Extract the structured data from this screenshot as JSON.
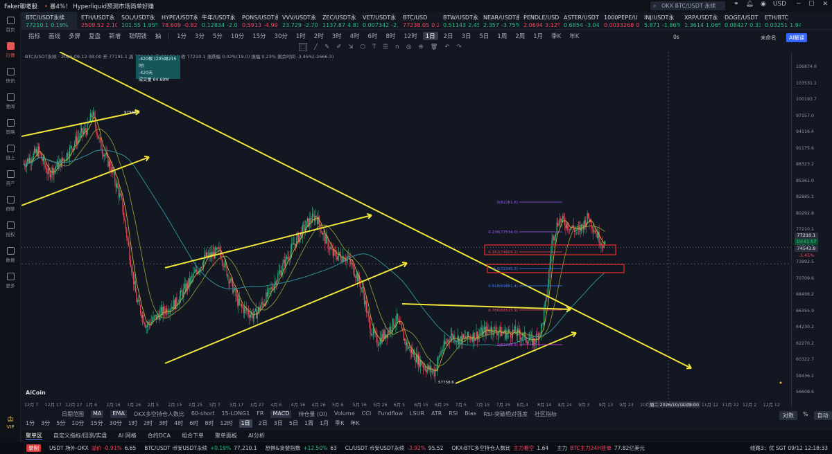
{
  "titlebar": {
    "app": "Faker聊老股",
    "news": "暴4%！ Hyperliquid预测市场简单好赚",
    "search_placeholder": "OKX BTC/USDT 永续",
    "currency": "USD"
  },
  "sidebar": [
    "首页",
    "行情",
    "快讯",
    "要闻",
    "策略",
    "链上",
    "资产",
    "群聊",
    "授权",
    "数据",
    "更多"
  ],
  "sidebar_active": 1,
  "vip": "VIP",
  "ticker": [
    {
      "n": "BTC/USDT永续",
      "p": "77210.1",
      "c": "0.19%",
      "d": "up"
    },
    {
      "n": "ETH/USDT永",
      "p": "2509.52",
      "c": "2.10%",
      "d": "dn"
    },
    {
      "n": "SOL/USDT永",
      "p": "101.55",
      "c": "1.95%",
      "d": "up"
    },
    {
      "n": "HYPE/USDT永",
      "p": "78.609",
      "c": "-0.82%",
      "d": "dn"
    },
    {
      "n": "牛年/USDT永",
      "p": "0.12834",
      "c": "-2.07%",
      "d": "up"
    },
    {
      "n": "PONS/USDT永",
      "p": "0.5913",
      "c": "-4.99%",
      "d": "dn"
    },
    {
      "n": "VVV/USDT永",
      "p": "23.729",
      "c": "-2.70%",
      "d": "up"
    },
    {
      "n": "ZEC/USDT永",
      "p": "1137.87",
      "c": "4.83%",
      "d": "up"
    },
    {
      "n": "VET/USDT永",
      "p": "0.007342",
      "c": "-2.34",
      "d": "up"
    },
    {
      "n": "BTC/USD",
      "p": "77238.05",
      "c": "0.201",
      "d": "dn"
    },
    {
      "n": "BTW/USDT永",
      "p": "0.51143",
      "c": "2.45%",
      "d": "up"
    },
    {
      "n": "NEAR/USDT永",
      "p": "2.357",
      "c": "-3.75%",
      "d": "up"
    },
    {
      "n": "PENDLE/USD",
      "p": "2.0694",
      "c": "3.12%",
      "d": "dn"
    },
    {
      "n": "ASTER/USDT",
      "p": "0.6854",
      "c": "-3.04%",
      "d": "up"
    },
    {
      "n": "1000PEPE/U",
      "p": "0.0033268",
      "c": "0.49",
      "d": "dn"
    },
    {
      "n": "INJ/USDT永",
      "p": "5.871",
      "c": "-1.86%",
      "d": "up"
    },
    {
      "n": "XRP/USDT永",
      "p": "1.3614",
      "c": "1.06%",
      "d": "up"
    },
    {
      "n": "DOGE/USDT",
      "p": "0.08427",
      "c": "0.33%",
      "d": "up"
    },
    {
      "n": "ETH/BTC",
      "p": "0.03251",
      "c": "1.94%",
      "d": "up"
    }
  ],
  "toolbar1": [
    "指标",
    "画线",
    "多屏",
    "复盘",
    "新增",
    "聪明钱",
    "抽",
    "1分",
    "3分",
    "5分",
    "10分",
    "15分",
    "30分",
    "1时",
    "2时",
    "3时",
    "4时",
    "6时",
    "8时",
    "12时",
    "1日",
    "2日",
    "3日",
    "5日",
    "1周",
    "2周",
    "1月",
    "季K",
    "年K"
  ],
  "toolbar1_active": "1日",
  "ratio": "0s",
  "unnamed": "未命名",
  "ai_button": "AI解读",
  "chart_info": "BTC/USDT永续 · 2026-09-12 08:00  开 77191.1  高 77346.8  低 77170.1  收 77210.1  涨跌幅 0.02%(19.0)  振幅 0.23%  剩余时间 -3.45%(-2666.3)",
  "tooltip": [
    "-420根 (205周215时)",
    "-420天",
    "成交量 64.69M"
  ],
  "yaxis": [
    "106874.6",
    "103531.1",
    "100193.7",
    "97157.0",
    "94116.4",
    "91175.6",
    "88323.2",
    "85361.0",
    "82885.1",
    "80292.8",
    "77210.1",
    "74543.8",
    "73992.5",
    "70709.6",
    "68498.2",
    "66355.9",
    "64230.2",
    "62270.2",
    "60322.7",
    "58436.1",
    "56608.6"
  ],
  "price_current": "77210.1",
  "price_timer": "19:41:07",
  "price_cross": "74543.8",
  "price_pct": "-3.45%",
  "xaxis": [
    "12月 7",
    "12月 17",
    "12月 27",
    "1月 6",
    "1月 16",
    "1月 26",
    "2月 5",
    "2月 15",
    "2月 25",
    "3月 7",
    "3月 17",
    "3月 27",
    "4月 6",
    "4月 16",
    "4月 26",
    "5月 6",
    "5月 16",
    "5月 26",
    "6月 5",
    "6月 15",
    "6月 25",
    "7月 5",
    "7月 15",
    "7月 25",
    "8月 4",
    "8月 14",
    "8月 24",
    "9月 3",
    "9月 13",
    "9月 23",
    "10月 3",
    "周二 2026/10/14 08:00",
    "11月 2",
    "11月 12",
    "11月 22",
    "12月 2",
    "12月 12"
  ],
  "fib": [
    {
      "label": "0(82261.6)",
      "c": "#9b59ff"
    },
    {
      "label": "0.236(77534.0)",
      "c": "#9b59ff"
    },
    {
      "label": "0.382(74609.2)",
      "c": "#f6465d"
    },
    {
      "label": "0.5(72245.3)",
      "c": "#3a7bff"
    },
    {
      "label": "0.618(69881.4)",
      "c": "#3a7bff"
    },
    {
      "label": "0.786(66515.9)",
      "c": "#f6465d"
    },
    {
      "label": "1(62228.6)",
      "c": "#e040fb"
    }
  ],
  "annotations": {
    "high_label": "97932.1",
    "low_label": "57758.6"
  },
  "logo": "AiCoin",
  "indicators": [
    "日期范围",
    "MA",
    "EMA",
    "OKX多空持仓人数比",
    "60-short",
    "15-LONG1",
    "FR",
    "MACD",
    "持仓量 (OI)",
    "Volume",
    "CCI",
    "Fundflow",
    "LSUR",
    "ATR",
    "RSI",
    "Bias",
    "RSI-突破相对强度",
    "社区指标"
  ],
  "indicator_selected": [
    "MA",
    "EMA",
    "MACD"
  ],
  "timeframes": [
    "1分",
    "3分",
    "5分",
    "10分",
    "15分",
    "30分",
    "1时",
    "2时",
    "3时",
    "4时",
    "6时",
    "8时",
    "12时",
    "1日",
    "2日",
    "3日",
    "5日",
    "1周",
    "1月",
    "季K",
    "年K"
  ],
  "tf_active": "1日",
  "right_ctrl": [
    "对数",
    "%",
    "自动"
  ],
  "bottom_tabs": [
    "聚单区",
    "自定义指标/回测/实盘",
    "AI 网格",
    "合约DCA",
    "组合下单",
    "聚单面板",
    "AI分析"
  ],
  "status": {
    "rec": "录制",
    "items": [
      {
        "t": "USDT 场外-OKX",
        "v": "溢价 -0.91%",
        "v2": "6.65"
      },
      {
        "t": "BTC/USDT 币安USDT永续",
        "v": "+0.19%",
        "v2": "77,210.1"
      },
      {
        "t": "恐惧&贪婪指数",
        "v": "+12.50%",
        "v2": "63"
      },
      {
        "t": "CL/USDT 币安USDT永续",
        "v": "-3.92%",
        "v2": "95.52"
      },
      {
        "t": "OKX-BTC多空持仓人数比",
        "v": "主力看空",
        "v2": "1.64"
      },
      {
        "t": "主力",
        "v": "BTC主力24H挂单",
        "v2": "77.82亿美元"
      }
    ],
    "right": "线路3：优  SGT 09/12 12:18:33"
  }
}
